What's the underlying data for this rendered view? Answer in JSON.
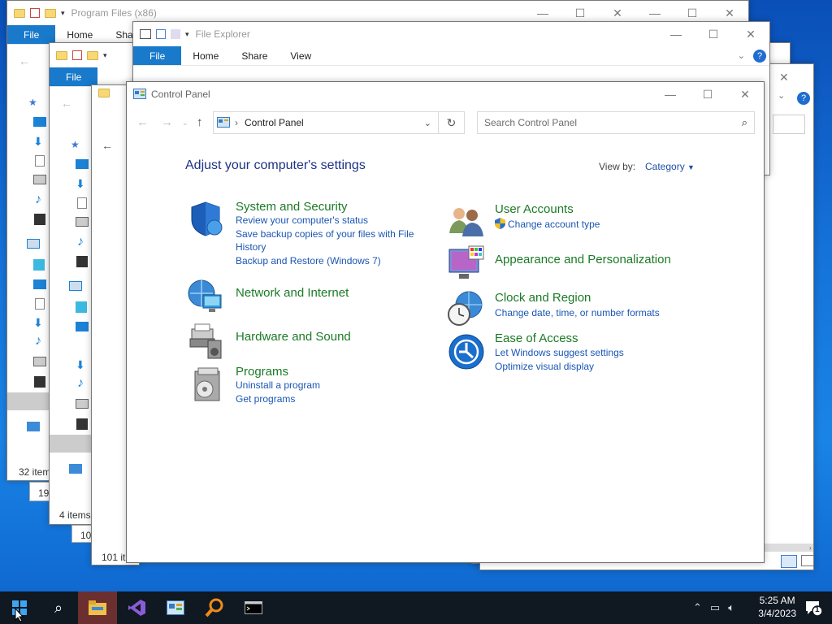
{
  "windows": {
    "back1": {
      "title": "Program Files (x86)",
      "status": "32 item",
      "status2": "19"
    },
    "back2": {
      "status": "4 items",
      "status2": "10"
    },
    "back3": {
      "status": "101 it"
    },
    "explorer": {
      "title": "File Explorer",
      "tabs": [
        "File",
        "Home",
        "Share",
        "View"
      ]
    },
    "back1_tabs": [
      "File",
      "Home",
      "Share"
    ],
    "back2_tabs": [
      "File"
    ]
  },
  "control_panel": {
    "title": "Control Panel",
    "address": "Control Panel",
    "search_placeholder": "Search Control Panel",
    "heading": "Adjust your computer's settings",
    "view_by_label": "View by:",
    "view_by_value": "Category",
    "categories": [
      {
        "title": "System and Security",
        "links": [
          "Review your computer's status",
          "Save backup copies of your files with File",
          "History",
          "Backup and Restore (Windows 7)"
        ]
      },
      {
        "title": "Network and Internet",
        "links": []
      },
      {
        "title": "Hardware and Sound",
        "links": []
      },
      {
        "title": "Programs",
        "links": [
          "Uninstall a program",
          "Get programs"
        ]
      },
      {
        "title": "User Accounts",
        "links": [
          "Change account type"
        ]
      },
      {
        "title": "Appearance and Personalization",
        "links": []
      },
      {
        "title": "Clock and Region",
        "links": [
          "Change date, time, or number formats"
        ]
      },
      {
        "title": "Ease of Access",
        "links": [
          "Let Windows suggest settings",
          "Optimize visual display"
        ]
      }
    ]
  },
  "taskbar": {
    "time": "5:25 AM",
    "date": "3/4/2023",
    "notification_count": "1"
  },
  "icons": [
    "start-icon",
    "search-icon",
    "file-explorer-icon",
    "visual-studio-icon",
    "control-panel-icon",
    "magnifier-icon",
    "terminal-icon"
  ]
}
